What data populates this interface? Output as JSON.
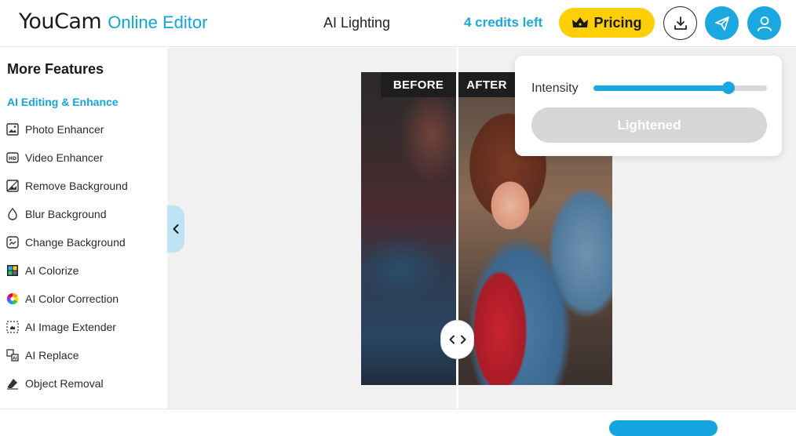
{
  "header": {
    "logo_main": "YouCam",
    "logo_sub": "Online Editor",
    "title": "AI Lighting",
    "credits": "4 credits left",
    "pricing_label": "Pricing"
  },
  "sidebar": {
    "title": "More Features",
    "section_label": "AI Editing & Enhance",
    "items": [
      {
        "label": "Photo Enhancer",
        "icon": "photo-icon"
      },
      {
        "label": "Video Enhancer",
        "icon": "hd-icon"
      },
      {
        "label": "Remove Background",
        "icon": "remove-bg-icon"
      },
      {
        "label": "Blur Background",
        "icon": "drop-icon"
      },
      {
        "label": "Change Background",
        "icon": "image-swap-icon"
      },
      {
        "label": "AI Colorize",
        "icon": "colorize-icon"
      },
      {
        "label": "AI Color Correction",
        "icon": "color-wheel-icon"
      },
      {
        "label": "AI Image Extender",
        "icon": "expand-icon"
      },
      {
        "label": "AI Replace",
        "icon": "replace-icon"
      },
      {
        "label": "Object Removal",
        "icon": "eraser-icon"
      }
    ]
  },
  "compare": {
    "before_label": "BEFORE",
    "after_label": "AFTER"
  },
  "panel": {
    "intensity_label": "Intensity",
    "intensity_value": 0.78,
    "button_label": "Lightened"
  },
  "colors": {
    "accent": "#1aa6e0",
    "pricing": "#ffcf06"
  }
}
